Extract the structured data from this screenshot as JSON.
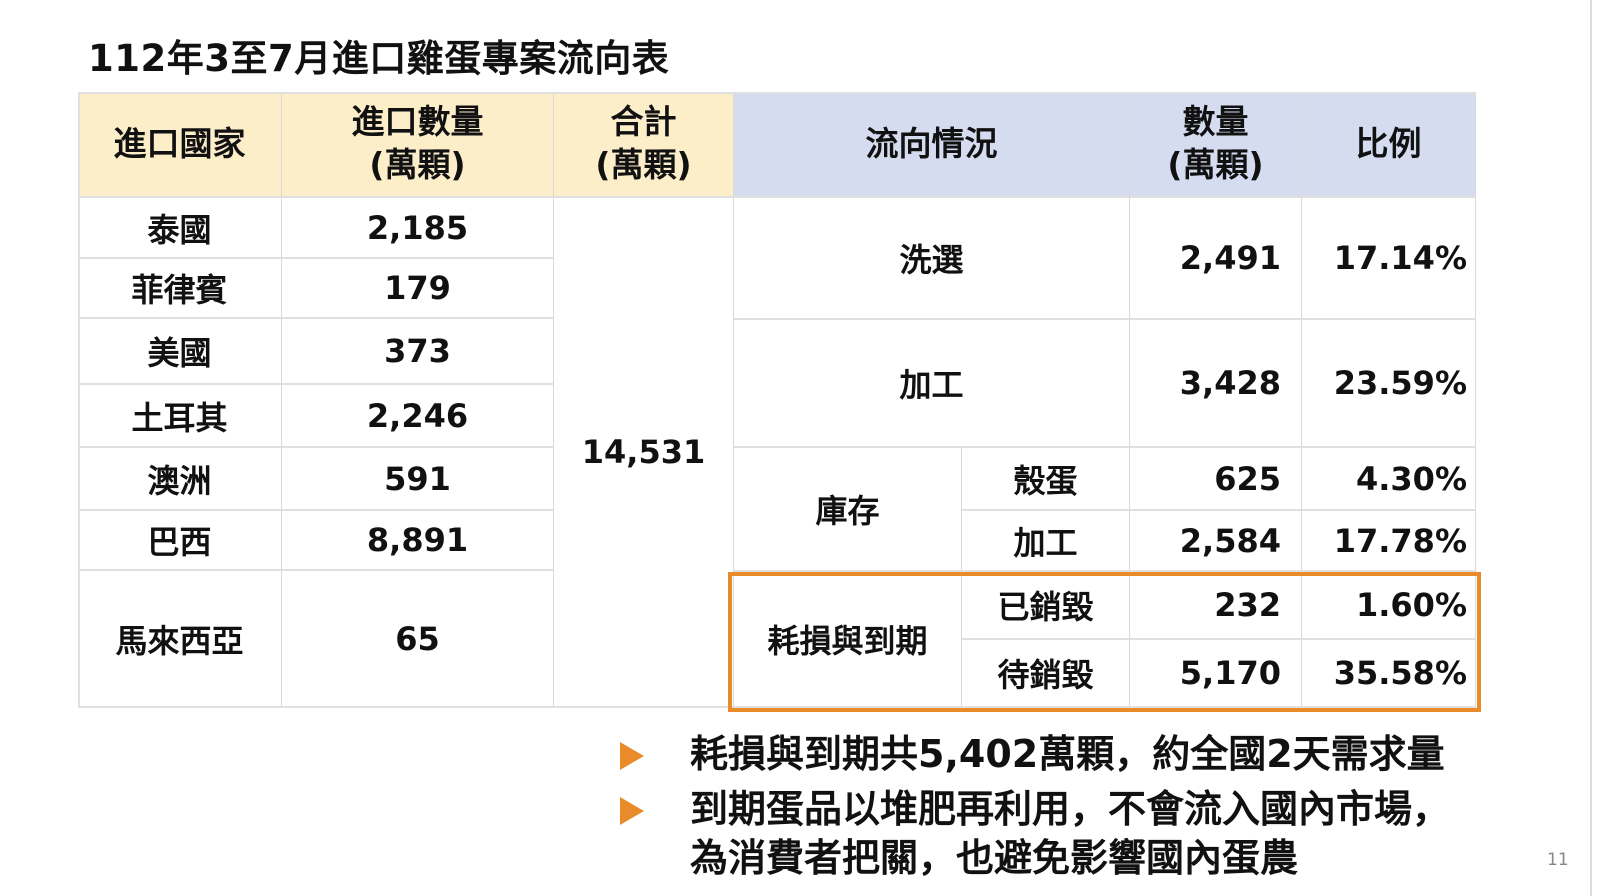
{
  "slide": {
    "title": "112年3至7月進口雞蛋專案流向表",
    "page_number": "11"
  },
  "table": {
    "headers": {
      "country": "進口國家",
      "import_qty_line1": "進口數量",
      "import_qty_line2": "(萬顆)",
      "total_line1": "合計",
      "total_line2": "(萬顆)",
      "flow": "流向情況",
      "qty_line1": "數量",
      "qty_line2": "(萬顆)",
      "ratio": "比例"
    },
    "imports": [
      {
        "country": "泰國",
        "qty": "2,185"
      },
      {
        "country": "菲律賓",
        "qty": "179"
      },
      {
        "country": "美國",
        "qty": "373"
      },
      {
        "country": "土耳其",
        "qty": "2,246"
      },
      {
        "country": "澳洲",
        "qty": "591"
      },
      {
        "country": "巴西",
        "qty": "8,891"
      },
      {
        "country": "馬來西亞",
        "qty": "65"
      }
    ],
    "total": "14,531",
    "flows": {
      "wash": {
        "label": "洗選",
        "qty": "2,491",
        "ratio": "17.14%"
      },
      "process": {
        "label": "加工",
        "qty": "3,428",
        "ratio": "23.59%"
      },
      "stock": {
        "label": "庫存",
        "shell": {
          "label": "殼蛋",
          "qty": "625",
          "ratio": "4.30%"
        },
        "processed": {
          "label": "加工",
          "qty": "2,584",
          "ratio": "17.78%"
        }
      },
      "loss": {
        "label": "耗損與到期",
        "destroyed": {
          "label": "已銷毀",
          "qty": "232",
          "ratio": "1.60%"
        },
        "pending": {
          "label": "待銷毀",
          "qty": "5,170",
          "ratio": "35.58%"
        }
      }
    }
  },
  "bullets": {
    "b1": "耗損與到期共5,402萬顆，約全國2天需求量",
    "b2_line1": "到期蛋品以堆肥再利用，不會流入國內市場，",
    "b2_line2": "為消費者把關，也避免影響國內蛋農"
  },
  "colors": {
    "header_left_bg": "#fdeeca",
    "header_right_bg": "#d6dcf0",
    "highlight": "#e98b2a"
  }
}
